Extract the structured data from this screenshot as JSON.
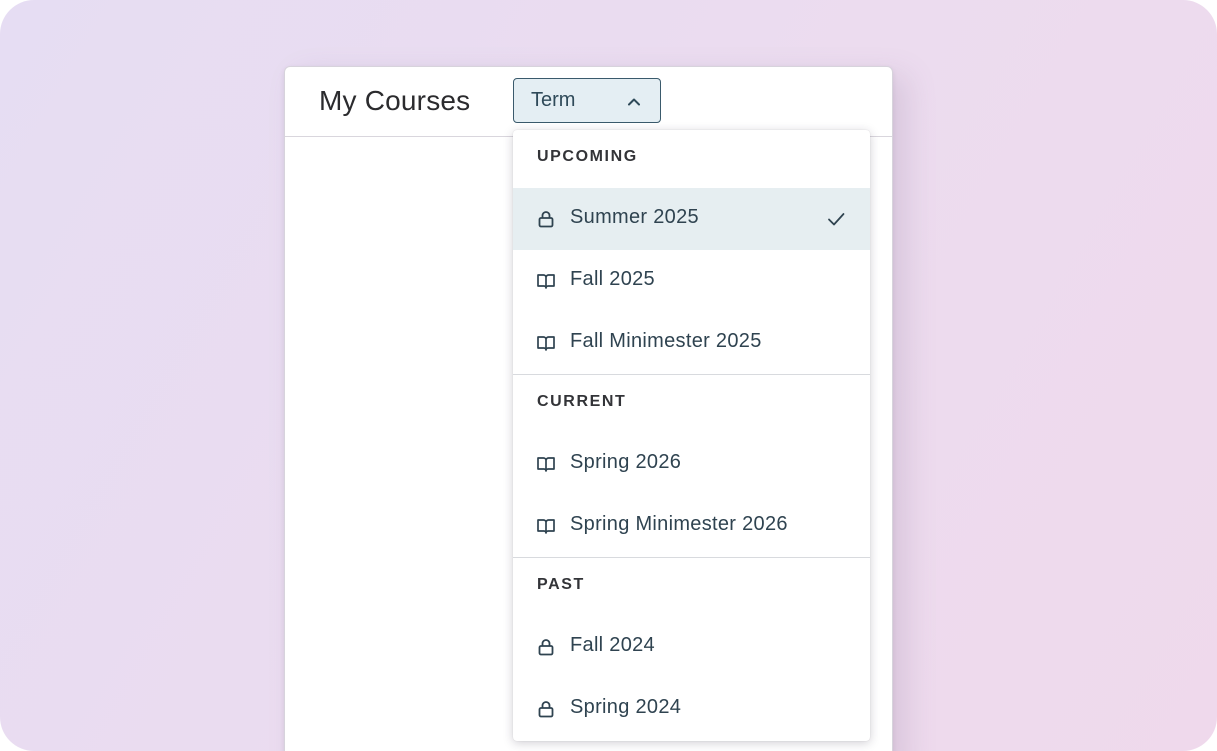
{
  "header": {
    "title": "My Courses",
    "term_button": {
      "label": "Term",
      "icon": "chevron-up-icon",
      "expanded": true
    }
  },
  "menu": {
    "groups": [
      {
        "label": "UPCOMING",
        "items": [
          {
            "label": "Summer 2025",
            "icon": "lock-icon",
            "selected": true
          },
          {
            "label": "Fall 2025",
            "icon": "book-icon",
            "selected": false
          },
          {
            "label": "Fall Minimester 2025",
            "icon": "book-icon",
            "selected": false
          }
        ]
      },
      {
        "label": "CURRENT",
        "items": [
          {
            "label": "Spring 2026",
            "icon": "book-icon",
            "selected": false
          },
          {
            "label": "Spring Minimester 2026",
            "icon": "book-icon",
            "selected": false
          }
        ]
      },
      {
        "label": "PAST",
        "items": [
          {
            "label": "Fall 2024",
            "icon": "lock-icon",
            "selected": false
          },
          {
            "label": "Spring 2024",
            "icon": "lock-icon",
            "selected": false
          }
        ]
      }
    ]
  },
  "colors": {
    "accent": "#3a5a6c",
    "selected_bg": "#e6eef1",
    "button_bg": "#e4eef3",
    "text": "#2f4350"
  }
}
